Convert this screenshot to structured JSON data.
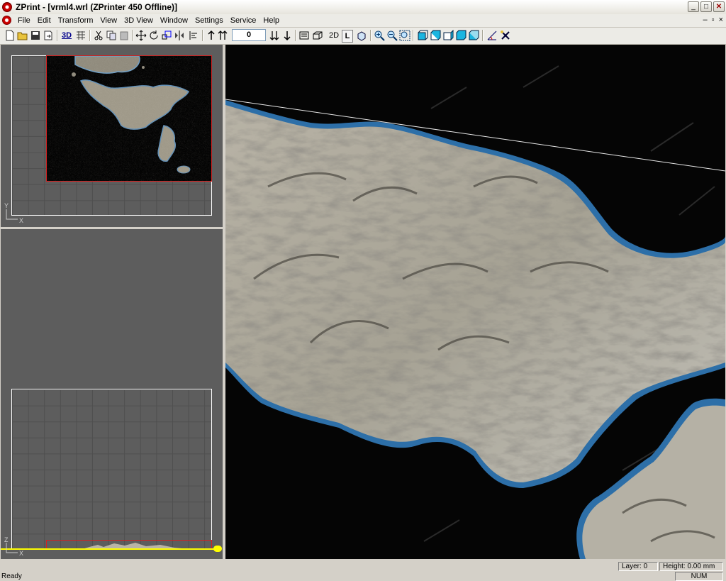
{
  "window": {
    "title": "ZPrint - [vrml4.wrl (ZPrinter 450 Offline)]",
    "minimize": "_",
    "maximize": "□",
    "close": "✕"
  },
  "menu": {
    "items": [
      "File",
      "Edit",
      "Transform",
      "View",
      "3D View",
      "Window",
      "Settings",
      "Service",
      "Help"
    ],
    "mdi_minimize": "–",
    "mdi_restore": "▫",
    "mdi_close": "×"
  },
  "toolbar": {
    "label_3d": "3D",
    "layer_value": "0",
    "label_2d": "2D",
    "label_l": "L",
    "icons": [
      "new-file-icon",
      "open-folder-icon",
      "save-icon",
      "export-icon",
      "3d-icon",
      "grid-icon",
      "cut-icon",
      "copy-icon",
      "paste-icon",
      "move-icon",
      "rotate-icon",
      "scale-icon",
      "mirror-icon",
      "align-icon",
      "layer-up-icon",
      "layers-up-icon",
      "layers-down-icon",
      "layer-down-icon",
      "view-2d-icon",
      "view-3d-icon",
      "zoom-in-icon",
      "zoom-out-icon",
      "zoom-fit-icon",
      "view-top-icon",
      "view-front-icon",
      "view-side-icon",
      "view-iso-icon",
      "view-persp-icon",
      "measure-icon",
      "tools-icon"
    ]
  },
  "panes": {
    "top_axis_y": "Y",
    "top_axis_x": "X",
    "side_axis_z": "Z",
    "side_axis_x": "X"
  },
  "status": {
    "ready": "Ready",
    "layer": "Layer: 0",
    "height": "Height: 0.00 mm",
    "num": "NUM"
  },
  "colors": {
    "accent": "#cc0000",
    "selection_box": "#d42020",
    "slider": "#ffff00",
    "sea": "#2a6aa8"
  }
}
